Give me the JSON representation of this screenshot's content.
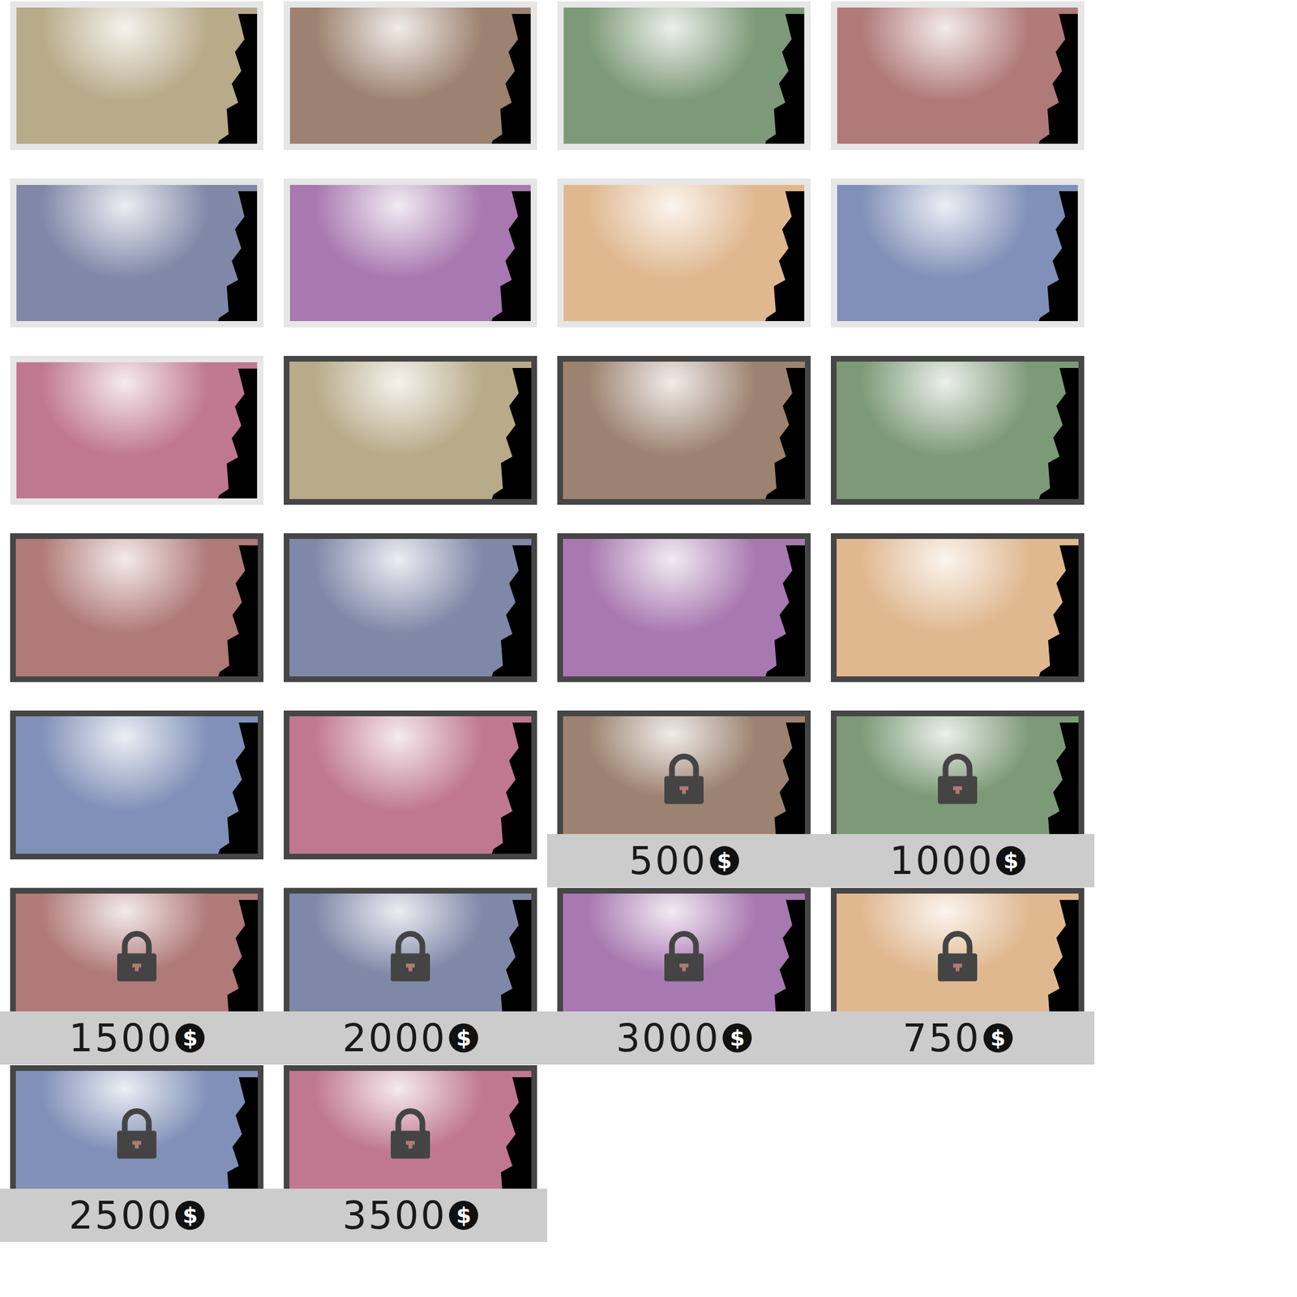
{
  "currency": "$",
  "backgrounds": [
    {
      "kind": "light",
      "color": "#b8ab8a"
    },
    {
      "kind": "light",
      "color": "#9c8270"
    },
    {
      "kind": "light",
      "color": "#7d9a78"
    },
    {
      "kind": "light",
      "color": "#b07a78"
    },
    {
      "kind": "light",
      "color": "#8088a8"
    },
    {
      "kind": "light",
      "color": "#a878b0"
    },
    {
      "kind": "light",
      "color": "#e0b890"
    },
    {
      "kind": "light",
      "color": "#8090b8"
    },
    {
      "kind": "light",
      "color": "#c07890"
    },
    {
      "kind": "dark",
      "color": "#b8ab8a"
    },
    {
      "kind": "dark",
      "color": "#9c8270"
    },
    {
      "kind": "dark",
      "color": "#7d9a78"
    },
    {
      "kind": "dark",
      "color": "#b07a78"
    },
    {
      "kind": "dark",
      "color": "#8088a8"
    },
    {
      "kind": "dark",
      "color": "#a878b0"
    },
    {
      "kind": "dark",
      "color": "#e0b890"
    },
    {
      "kind": "dark",
      "color": "#8090b8"
    },
    {
      "kind": "dark",
      "color": "#c07890"
    },
    {
      "kind": "locked",
      "color": "#9c8270",
      "price": "500"
    },
    {
      "kind": "locked",
      "color": "#7d9a78",
      "price": "1000"
    },
    {
      "kind": "locked",
      "color": "#b07a78",
      "price": "1500"
    },
    {
      "kind": "locked",
      "color": "#8088a8",
      "price": "2000"
    },
    {
      "kind": "locked",
      "color": "#a878b0",
      "price": "3000"
    },
    {
      "kind": "locked",
      "color": "#e0b890",
      "price": "750"
    },
    {
      "kind": "locked",
      "color": "#8090b8",
      "price": "2500"
    },
    {
      "kind": "locked",
      "color": "#c07890",
      "price": "3500"
    }
  ]
}
